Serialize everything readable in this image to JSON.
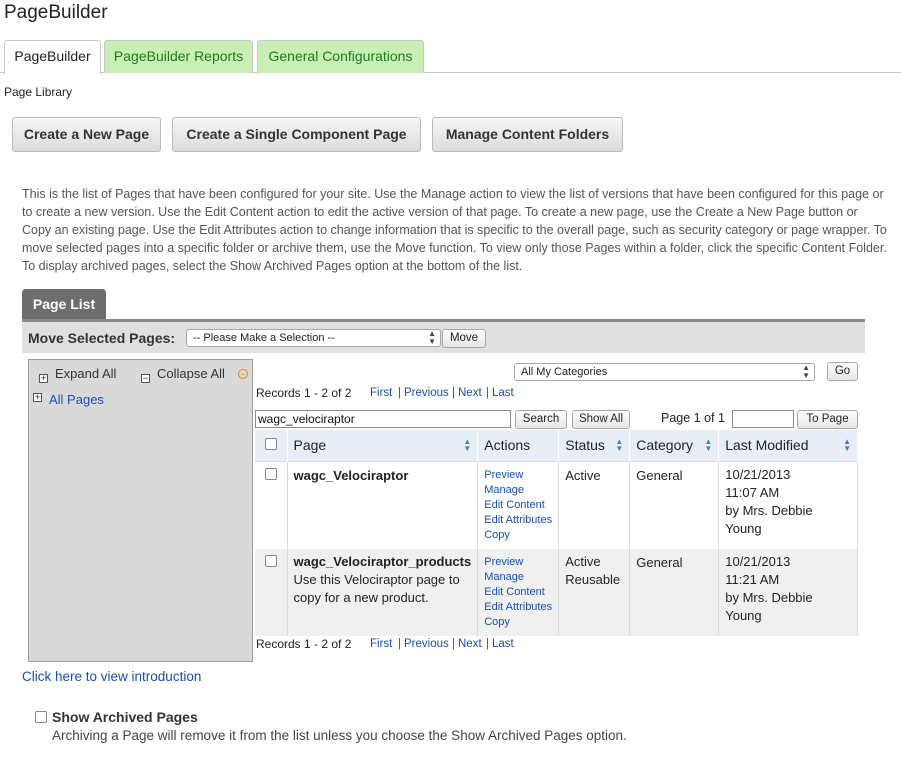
{
  "app": {
    "title": "PageBuilder"
  },
  "tabs": [
    {
      "label": "PageBuilder",
      "active": true
    },
    {
      "label": "PageBuilder Reports",
      "active": false
    },
    {
      "label": "General Configurations",
      "active": false
    }
  ],
  "section_label": "Page Library",
  "actions": {
    "create_new": "Create a New Page",
    "create_single": "Create a Single Component Page",
    "manage_folders": "Manage Content Folders"
  },
  "intro_text": "This is the list of Pages that have been configured for your site. Use the Manage action to view the list of versions that have been configured for this page or to create a new version. Use the Edit Content action to edit the active version of that page. To create a new page, use the Create a New Page button or Copy an existing page. Use the Edit Attributes action to change information that is specific to the overall page, such as security category or page wrapper. To move selected pages into a specific folder or archive them, use the Move function. To view only those Pages within a folder, click the specific Content Folder. To display archived pages, select the Show Archived Pages option at the bottom of the list.",
  "page_list": {
    "tab_label": "Page List",
    "move_label": "Move Selected Pages:",
    "move_select": "-- Please Make a Selection --",
    "move_button": "Move"
  },
  "tree": {
    "expand_all": "Expand All",
    "collapse_all": "Collapse All",
    "all_pages": "All Pages"
  },
  "filter": {
    "category_select": "All My Categories",
    "go_button": "Go",
    "search_value": "wagc_velociraptor",
    "search_button": "Search",
    "show_all_button": "Show All",
    "page_label": "Page 1 of 1",
    "to_page_button": "To Page"
  },
  "pager": {
    "records": "Records 1 - 2 of 2",
    "first": "First",
    "previous": "Previous",
    "next": "Next",
    "last": "Last",
    "separator": "|"
  },
  "table": {
    "headers": {
      "page": "Page",
      "actions": "Actions",
      "status": "Status",
      "category": "Category",
      "last_modified": "Last Modified"
    },
    "rows": [
      {
        "name": "wagc_Velociraptor",
        "description": "",
        "actions": [
          "Preview",
          "Manage",
          "Edit Content",
          "Edit Attributes",
          "Copy"
        ],
        "status": "Active",
        "status2": "",
        "category": "General",
        "modified_date": "10/21/2013",
        "modified_time": "11:07 AM",
        "modified_by": "by Mrs. Debbie Young"
      },
      {
        "name": "wagc_Velociraptor_products",
        "description": "Use this Velociraptor page to copy for a new product.",
        "actions": [
          "Preview",
          "Manage",
          "Edit Content",
          "Edit Attributes",
          "Copy"
        ],
        "status": "Active",
        "status2": "Reusable",
        "category": "General",
        "modified_date": "10/21/2013",
        "modified_time": "11:21 AM",
        "modified_by": "by Mrs. Debbie Young"
      }
    ]
  },
  "footer": {
    "intro_link": "Click here to view introduction",
    "show_archived": "Show Archived Pages",
    "archived_note": "Archiving a Page will remove it from the list unless you choose the Show Archived Pages option."
  },
  "colors": {
    "tab_green": "#c9efb6",
    "link_blue": "#1a4ea8",
    "header_bg": "#e8eef5",
    "collapse_orange": "#e08a00"
  }
}
